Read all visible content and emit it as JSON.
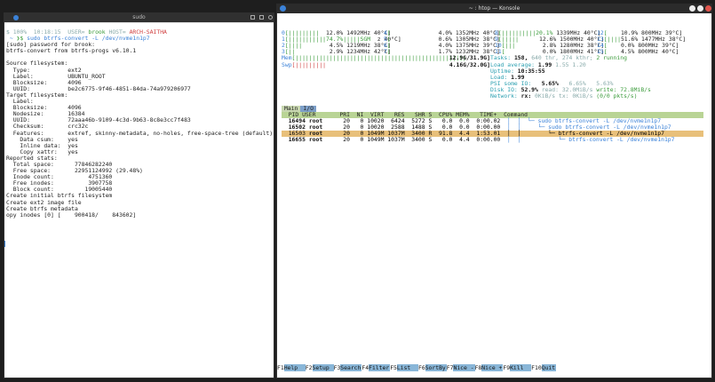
{
  "left_window": {
    "title": "sudo",
    "lines": [
      {
        "id": "prompt",
        "parts": [
          {
            "t": "$ ",
            "c": "c-dim"
          },
          {
            "t": "100%  ",
            "c": "c-dim"
          },
          {
            "t": "10:18:15  ",
            "c": "c-dim"
          },
          {
            "t": "USER",
            "c": "c-dim"
          },
          {
            "t": "= ",
            "c": "c-dim"
          },
          {
            "t": "brook ",
            "c": "prompt-user"
          },
          {
            "t": "HOST",
            "c": "c-dim"
          },
          {
            "t": "= ",
            "c": "c-dim"
          },
          {
            "t": "ARCH-SAITHA",
            "c": "prompt-host"
          }
        ]
      },
      {
        "id": "cmd",
        "parts": [
          {
            "t": " ~ ",
            "c": "c-blu"
          },
          {
            "t": "❯$ ",
            "c": "c-grn"
          },
          {
            "t": "sudo btrfs-convert ",
            "c": "c-blu"
          },
          {
            "t": "-L ",
            "c": "c-blu"
          },
          {
            "t": "/dev/nvme1n1p7",
            "c": "c-blu"
          }
        ]
      },
      {
        "id": "l3",
        "text": "[sudo] password for brook:"
      },
      {
        "id": "l4",
        "text": "btrfs-convert from btrfs-progs v6.10.1"
      },
      {
        "id": "l5",
        "text": ""
      },
      {
        "id": "l6",
        "text": "Source filesystem:"
      },
      {
        "id": "l7",
        "text": "  Type:           ext2"
      },
      {
        "id": "l8",
        "text": "  Label:          UBUNTU_ROOT"
      },
      {
        "id": "l9",
        "text": "  Blocksize:      4096"
      },
      {
        "id": "l10",
        "text": "  UUID:           be2c6775-9f46-4851-84da-74a979206977"
      },
      {
        "id": "l11",
        "text": "Target filesystem:"
      },
      {
        "id": "l12",
        "text": "  Label:"
      },
      {
        "id": "l13",
        "text": "  Blocksize:      4096"
      },
      {
        "id": "l14",
        "text": "  Nodesize:       16384"
      },
      {
        "id": "l15",
        "text": "  UUID:           72aaa46b-9109-4c3d-9b63-8c8e3cc7f483"
      },
      {
        "id": "l16",
        "text": "  Checksum:       crc32c"
      },
      {
        "id": "l17",
        "text": "  Features:       extref, skinny-metadata, no-holes, free-space-tree (default)"
      },
      {
        "id": "l18",
        "text": "    Data csum:    yes"
      },
      {
        "id": "l19",
        "text": "    Inline data:  yes"
      },
      {
        "id": "l20",
        "text": "    Copy xattr:   yes"
      },
      {
        "id": "l21",
        "text": "Reported stats:"
      },
      {
        "id": "l22",
        "text": "  Total space:      77846282240"
      },
      {
        "id": "l23",
        "text": "  Free space:       22951124992 (29.48%)"
      },
      {
        "id": "l24",
        "text": "  Inode count:          4751360"
      },
      {
        "id": "l25",
        "text": "  Free inodes:          3907758"
      },
      {
        "id": "l26",
        "text": "  Block count:         19005440"
      },
      {
        "id": "l27",
        "text": "Create initial btrfs filesystem"
      },
      {
        "id": "l28",
        "text": "Create ext2 image file"
      },
      {
        "id": "l29",
        "text": "Create btrfs metadata"
      },
      {
        "id": "l30",
        "text": "opy inodes [0] [    900418/    843602]"
      }
    ]
  },
  "right_window": {
    "title": "~ : htop — Konsole"
  },
  "htop": {
    "cpus": [
      {
        "col": 0,
        "id": "0",
        "bar": "[|||||||||  ",
        "pct": "12.0%",
        "freq": "1492MHz",
        "temp": "40°C]"
      },
      {
        "col": 0,
        "id": "1",
        "bar": "[|||||||||||74.7%|||||SGM ",
        "pct": "",
        "freq": "z",
        "temp": "40°C]"
      },
      {
        "col": 0,
        "id": "2",
        "bar": "[||||        ",
        "pct": "4.5%",
        "freq": "1219MHz",
        "temp": "38°C]"
      },
      {
        "col": 0,
        "id": "3",
        "bar": "[||          ",
        "pct": "2.9%",
        "freq": "1234MHz",
        "temp": "42°C]"
      },
      {
        "col": 1,
        "id": "4",
        "bar": "[              ",
        "pct": "4.0%",
        "freq": "1352MHz",
        "temp": "40°C]"
      },
      {
        "col": 1,
        "id": "5",
        "bar": "[              ",
        "pct": "0.6%",
        "freq": "1305MHz",
        "temp": "38°C]"
      },
      {
        "col": 1,
        "id": "6",
        "bar": "[              ",
        "pct": "4.0%",
        "freq": "1375MHz",
        "temp": "39°C]"
      },
      {
        "col": 1,
        "id": "7",
        "bar": "[              ",
        "pct": "1.7%",
        "freq": "1232MHz",
        "temp": "38°C]"
      },
      {
        "col": 2,
        "id": "8",
        "bar": "[||||||||||20.1%",
        "pct": "",
        "freq": "1339MHz",
        "temp": "40°C]"
      },
      {
        "col": 2,
        "id": "9",
        "bar": "[|||||      ",
        "pct": "12.6%",
        "freq": "1500MHz",
        "temp": "40°C]"
      },
      {
        "col": 2,
        "id": "10",
        "bar": "[|||        ",
        "pct": "2.8%",
        "freq": "1280MHz",
        "temp": "38°C]"
      },
      {
        "col": 2,
        "id": "11",
        "bar": "[           ",
        "pct": "0.0%",
        "freq": "1800MHz",
        "temp": "41°C]"
      },
      {
        "col": 3,
        "id": "12",
        "bar": "[    ",
        "pct": "10.9%",
        "freq": "800MHz",
        "temp": "39°C]"
      },
      {
        "col": 3,
        "id": "13",
        "bar": "[||||",
        "pct": "51.6%",
        "freq": "1477MHz",
        "temp": "38°C]"
      },
      {
        "col": 3,
        "id": "14",
        "bar": "[    ",
        "pct": "0.0%",
        "freq": "800MHz",
        "temp": "39°C]"
      },
      {
        "col": 3,
        "id": "15",
        "bar": "[    ",
        "pct": "4.5%",
        "freq": "800MHz",
        "temp": "40°C]"
      }
    ],
    "mem": {
      "label": "Mem",
      "bar": "[||||||||||||||||||||||||||||||||||||||||||||||||||",
      "value": "12.9G/31.9G]"
    },
    "swp": {
      "label": "Swp",
      "bar": "[|||||||||",
      "value": "4.16G/32.0G]"
    },
    "stats": [
      {
        "label": "Tasks: ",
        "value": "158, ",
        "extra": "640 thr, ",
        "extra2": "274 kthr; ",
        "extra3": "2 running"
      },
      {
        "label": "Load average: ",
        "value": "1.99 ",
        "extra": "1.55 ",
        "extra2": "1.20",
        "extra3": ""
      },
      {
        "label": "Uptime: ",
        "value": "10:35:55",
        "extra": "",
        "extra2": "",
        "extra3": ""
      },
      {
        "label": "Load: ",
        "value": "1.99",
        "extra": "",
        "extra2": "",
        "extra3": ""
      },
      {
        "label": "PSI some IO:   ",
        "value": "5.65% ",
        "extra": "  6.65% ",
        "extra2": "  5.63%",
        "extra3": ""
      },
      {
        "label": "Disk IO: ",
        "value": "52.9% ",
        "extra": "read: ",
        "extra2": "32.0MiB/s ",
        "extra3": "write: 72.8MiB/s"
      },
      {
        "label": "Network: ",
        "value": "rx: ",
        "extra": "0KiB/s ",
        "extra2": "tx: 0KiB/s ",
        "extra3": "(0/0 pkts/s)"
      }
    ],
    "tabs": [
      "Main",
      "I/O"
    ],
    "header": "  PID USER       PRI  NI  VIRT   RES   SHR S  CPU% MEM%   TIME+  Command",
    "processes": [
      {
        "pid": "16494",
        "user": "root",
        "pri": "20",
        "ni": "0",
        "virt": "10020",
        "res": "6424",
        "shr": "5272",
        "s": "S",
        "cpu": "0.0",
        "mem": "0.0",
        "time": "0:00.02",
        "cmd": "│  │  └─ sudo btrfs-convert -L /dev/nvme1n1p7",
        "sel": false
      },
      {
        "pid": "16502",
        "user": "root",
        "pri": "20",
        "ni": "0",
        "virt": "10020",
        "res": "2588",
        "shr": "1488",
        "s": "S",
        "cpu": "0.0",
        "mem": "0.0",
        "time": "0:00.00",
        "cmd": "│  │     └─ sudo btrfs-convert -L /dev/nvme1n1p7",
        "sel": false
      },
      {
        "pid": "16503",
        "user": "root",
        "pri": "20",
        "ni": "0",
        "virt": "1049M",
        "res": "1037M",
        "shr": "3400",
        "s": "R",
        "cpu": "91.8",
        "mem": "4.4",
        "time": "1:53.01",
        "cmd": "│  │        └─ btrfs-convert -L /dev/nvme1n1p7",
        "sel": true
      },
      {
        "pid": "16655",
        "user": "root",
        "pri": "20",
        "ni": "0",
        "virt": "1049M",
        "res": "1037M",
        "shr": "3400",
        "s": "S",
        "cpu": "0.0",
        "mem": "4.4",
        "time": "0:00.00",
        "cmd": "│  │           └─ btrfs-convert -L /dev/nvme1n1p7",
        "sel": false
      }
    ],
    "fkeys": [
      {
        "k": "F1",
        "l": "Help  "
      },
      {
        "k": "F2",
        "l": "Setup "
      },
      {
        "k": "F3",
        "l": "Search"
      },
      {
        "k": "F4",
        "l": "Filter"
      },
      {
        "k": "F5",
        "l": "List  "
      },
      {
        "k": "F6",
        "l": "SortBy"
      },
      {
        "k": "F7",
        "l": "Nice -"
      },
      {
        "k": "F8",
        "l": "Nice +"
      },
      {
        "k": "F9",
        "l": "Kill  "
      },
      {
        "k": "F10",
        "l": "Quit"
      }
    ]
  }
}
